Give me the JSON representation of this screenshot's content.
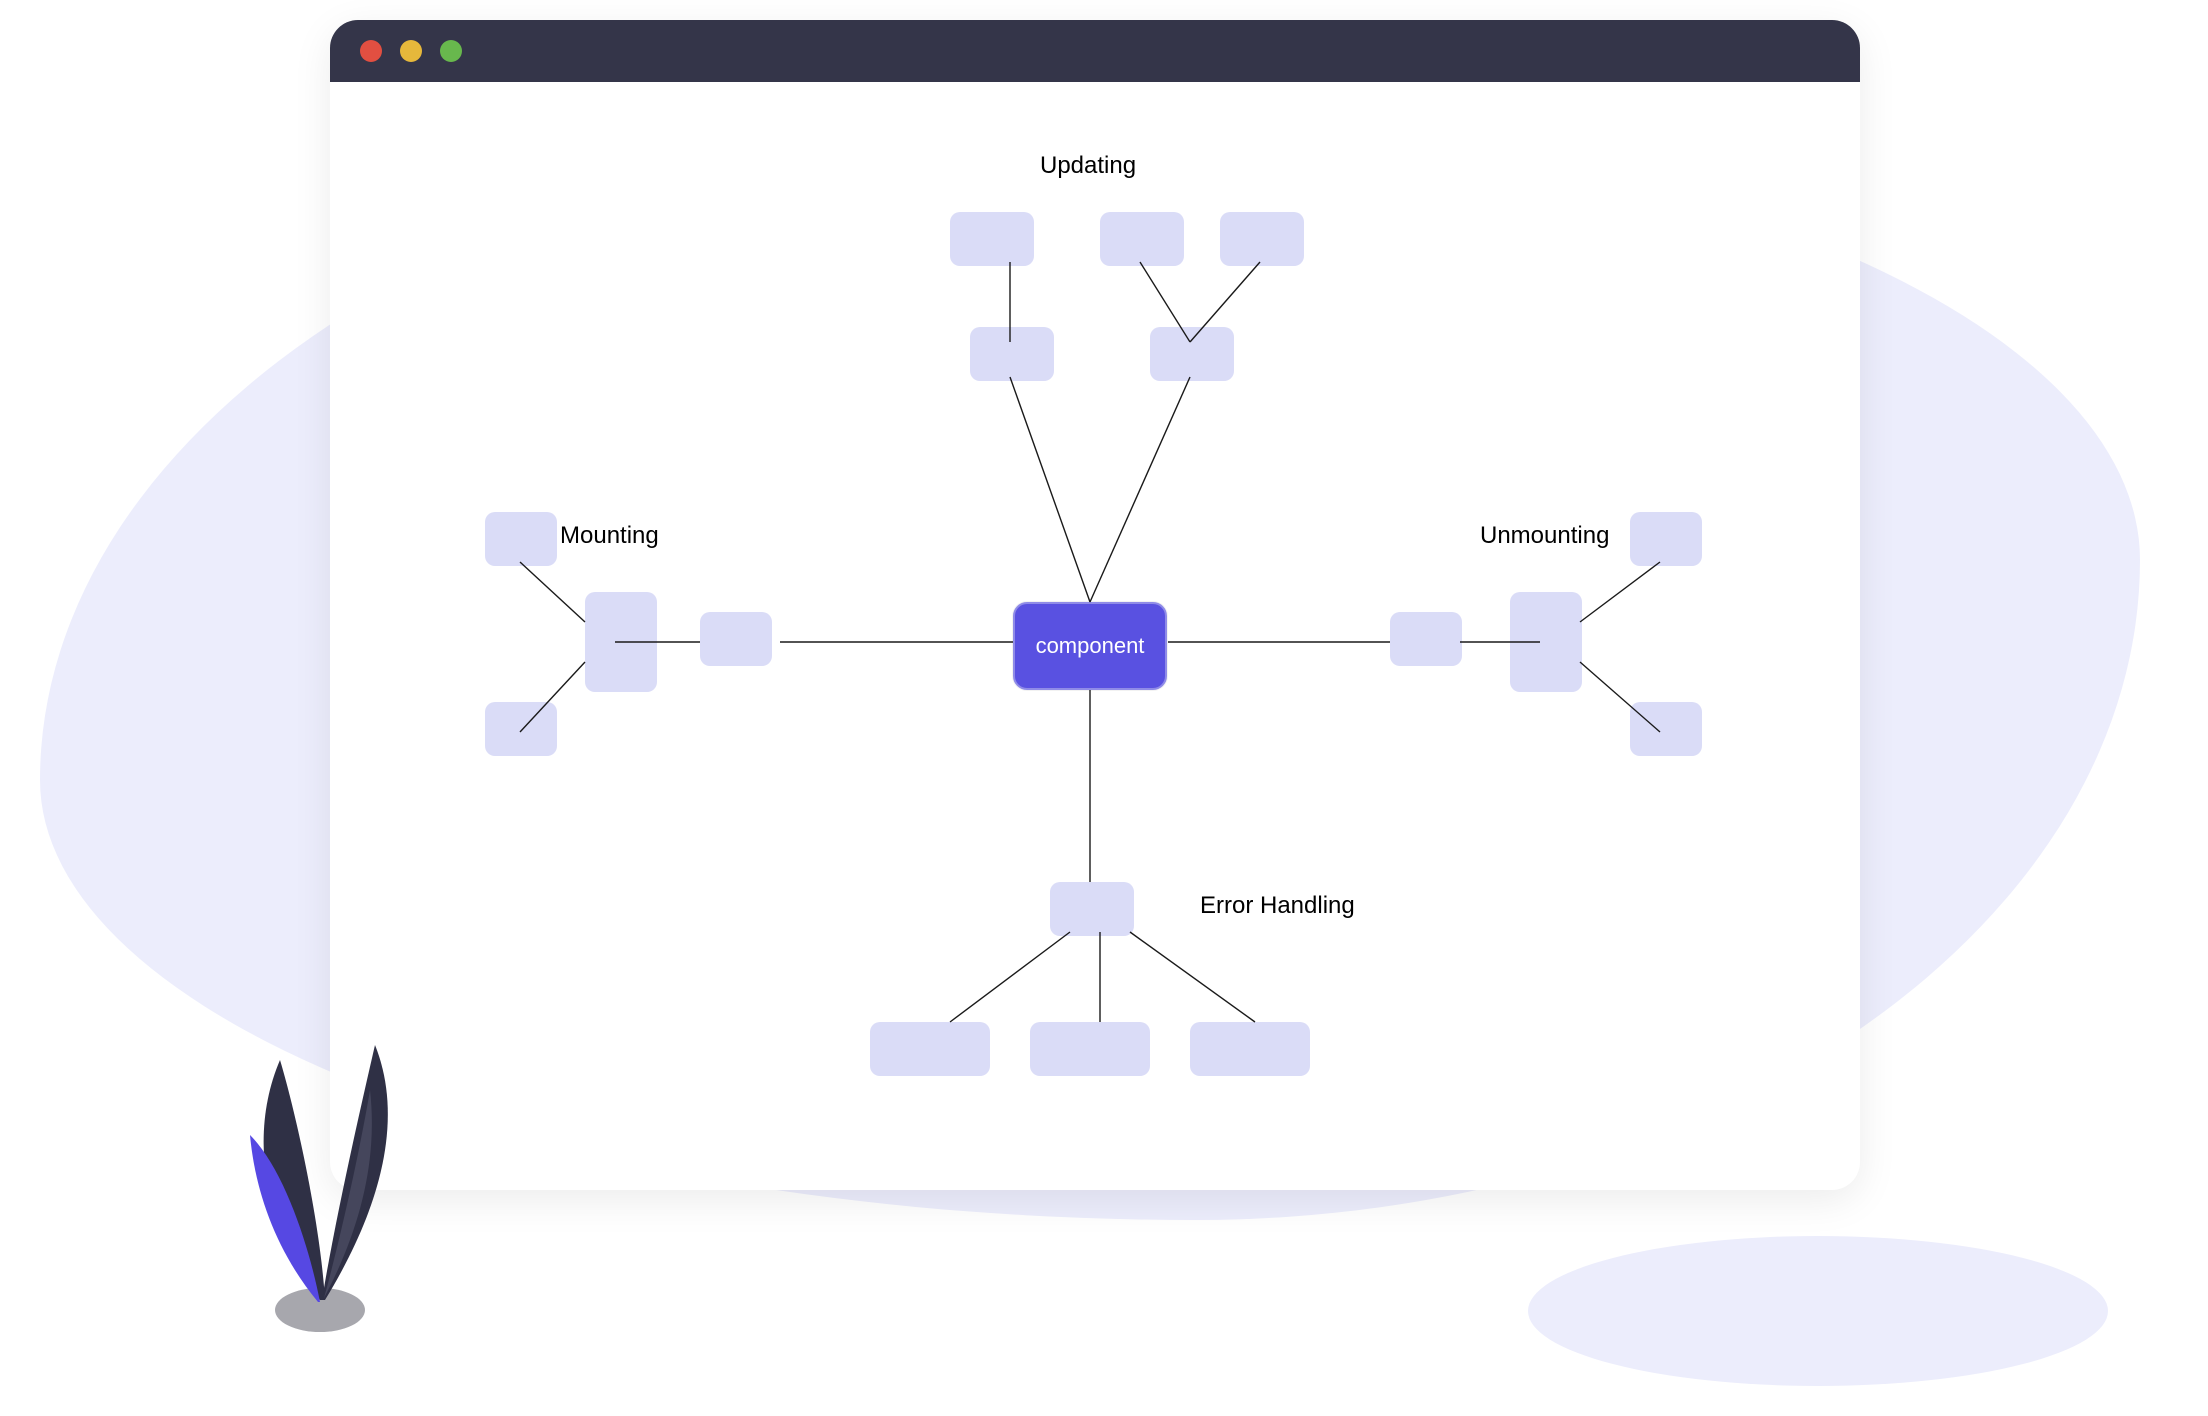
{
  "window": {
    "traffic_lights": {
      "close_color": "#e24f41",
      "minimize_color": "#e6b83b",
      "zoom_color": "#68b84d"
    }
  },
  "diagram": {
    "center_label": "component",
    "sections": {
      "top": "Updating",
      "left": "Mounting",
      "right": "Unmounting",
      "bottom": "Error Handling"
    }
  },
  "colors": {
    "node_fill": "#dadcf7",
    "center_fill": "#5951e1",
    "titlebar": "#343549",
    "bg_blob": "#ecedfc"
  }
}
